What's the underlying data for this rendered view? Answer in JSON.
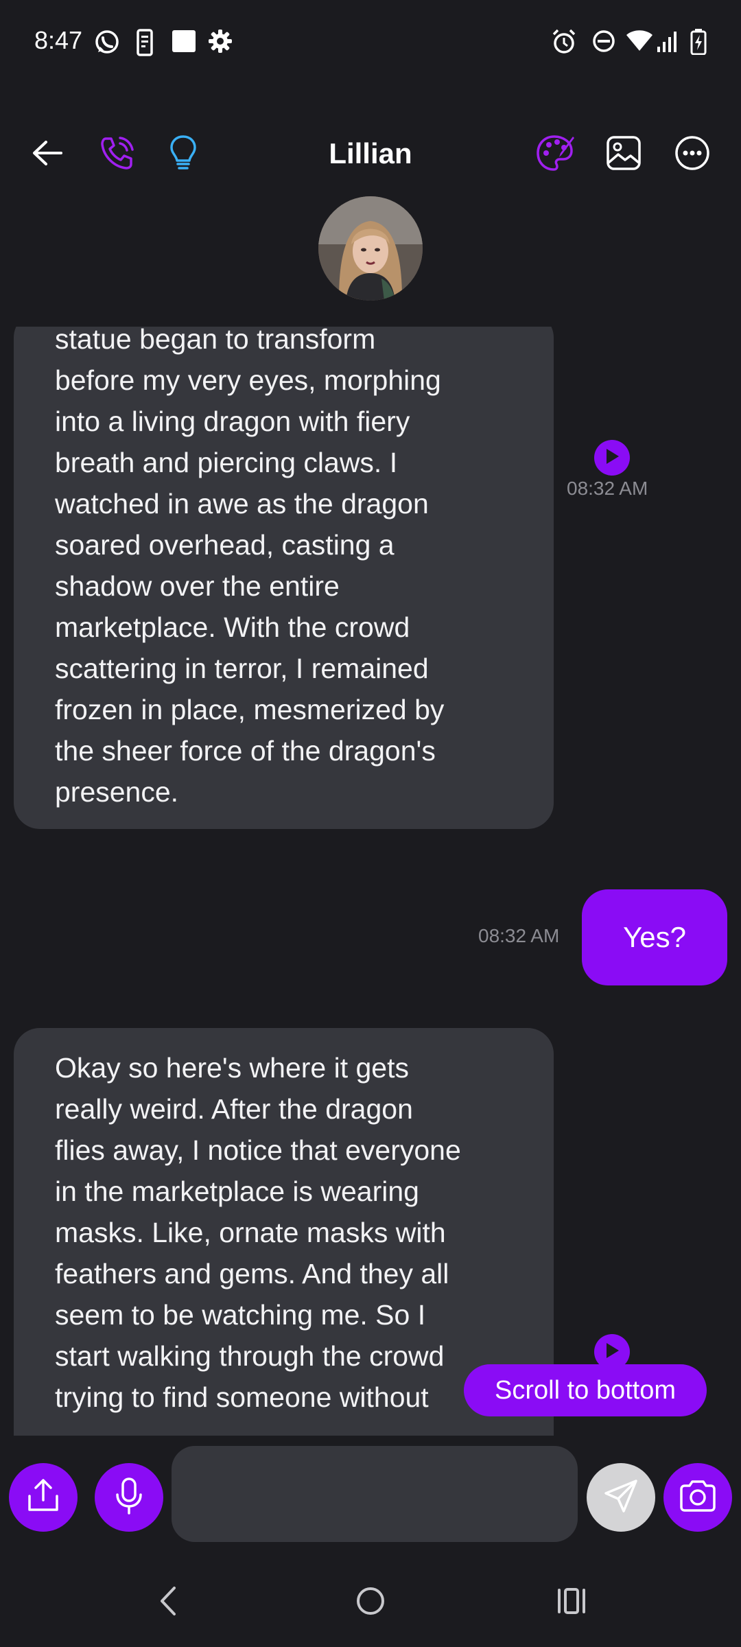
{
  "status_bar": {
    "time": "8:47",
    "left_icons": [
      "whatsapp-icon",
      "phone-device-icon",
      "square-icon",
      "settings-icon"
    ],
    "right_icons": [
      "alarm-icon",
      "dnd-icon",
      "wifi-icon",
      "signal-icon",
      "battery-icon"
    ]
  },
  "header": {
    "contact_name": "Lillian",
    "icons": [
      "back-arrow-icon",
      "phone-call-icon",
      "lightbulb-icon",
      "palette-icon",
      "image-icon",
      "more-icon"
    ]
  },
  "messages": [
    {
      "direction": "incoming",
      "lines": [
        "statue began to transform",
        "before my very eyes, morphing",
        "into a living dragon with fiery",
        "breath and piercing claws. I",
        "watched in awe as the dragon",
        "soared overhead, casting a",
        "shadow over the entire",
        "marketplace. With the crowd",
        "scattering in terror, I remained",
        "frozen in place, mesmerized by",
        "the sheer force of the dragon's",
        "presence."
      ],
      "time": "08:32 AM"
    },
    {
      "direction": "outgoing",
      "text": "Yes?",
      "time": "08:32 AM"
    },
    {
      "direction": "incoming",
      "lines": [
        "Okay so here's where it gets",
        "really weird. After the dragon",
        "flies away, I notice that everyone",
        "in the marketplace is wearing",
        "masks. Like, ornate masks with",
        "feathers and gems. And they all",
        "seem to be watching me. So I",
        "start walking through the crowd",
        "trying to find someone without"
      ]
    }
  ],
  "scroll_to_bottom_label": "Scroll to bottom",
  "input": {
    "placeholder": "",
    "buttons": [
      "share-icon",
      "microphone-icon",
      "send-icon",
      "camera-icon"
    ]
  },
  "colors": {
    "background": "#1b1b1f",
    "bubble_incoming": "#36373d",
    "accent": "#8a0cf5",
    "lightbulb": "#3ab0f5",
    "timestamp": "#8c8c93"
  }
}
